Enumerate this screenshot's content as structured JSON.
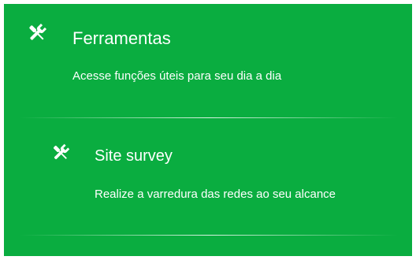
{
  "colors": {
    "panel_background": "#0aad40",
    "text": "#ffffff",
    "page_background": "#ffffff"
  },
  "header": {
    "icon": "tools-icon",
    "title": "Ferramentas",
    "subtitle": "Acesse funções úteis para seu dia a dia"
  },
  "items": [
    {
      "icon": "tools-icon",
      "title": "Site survey",
      "description": "Realize a varredura das redes ao seu alcance"
    }
  ]
}
